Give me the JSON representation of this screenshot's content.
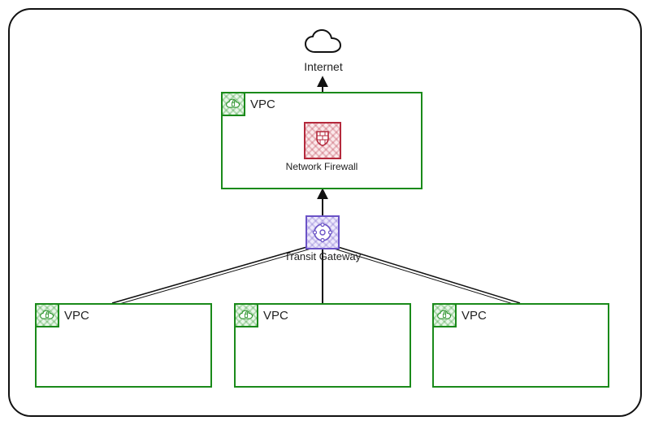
{
  "internet": {
    "label": "Internet"
  },
  "egress_vpc": {
    "label": "VPC",
    "firewall_label": "Network Firewall"
  },
  "transit_gateway": {
    "label": "Transit Gateway"
  },
  "spoke_vpc_left": {
    "label": "VPC"
  },
  "spoke_vpc_center": {
    "label": "VPC"
  },
  "spoke_vpc_right": {
    "label": "VPC"
  },
  "chart_data": {
    "type": "diagram",
    "title": "",
    "nodes": [
      {
        "id": "internet",
        "label": "Internet",
        "kind": "internet"
      },
      {
        "id": "egress_vpc",
        "label": "VPC",
        "kind": "vpc"
      },
      {
        "id": "network_firewall",
        "label": "Network Firewall",
        "kind": "aws-network-firewall",
        "parent": "egress_vpc"
      },
      {
        "id": "transit_gateway",
        "label": "Transit Gateway",
        "kind": "aws-transit-gateway"
      },
      {
        "id": "spoke_vpc_left",
        "label": "VPC",
        "kind": "vpc"
      },
      {
        "id": "spoke_vpc_center",
        "label": "VPC",
        "kind": "vpc"
      },
      {
        "id": "spoke_vpc_right",
        "label": "VPC",
        "kind": "vpc"
      }
    ],
    "edges": [
      {
        "from": "network_firewall",
        "to": "internet",
        "directed": true
      },
      {
        "from": "transit_gateway",
        "to": "egress_vpc",
        "directed": true
      },
      {
        "from": "transit_gateway",
        "to": "spoke_vpc_left",
        "directed": false
      },
      {
        "from": "transit_gateway",
        "to": "spoke_vpc_center",
        "directed": false
      },
      {
        "from": "transit_gateway",
        "to": "spoke_vpc_right",
        "directed": false
      }
    ]
  }
}
